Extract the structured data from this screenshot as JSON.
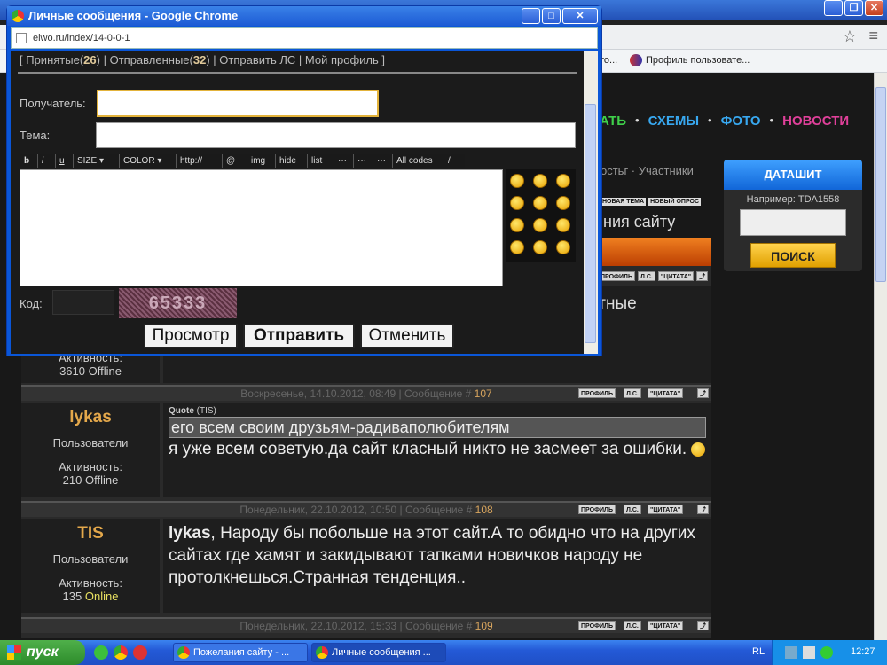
{
  "background": {
    "bookmark": "Профиль пользовате...",
    "bookmark_prefix": "то...",
    "nav": [
      {
        "label": "АТЬ",
        "color": "#3fd04a"
      },
      {
        "label": "СХЕМЫ",
        "color": "#38a8f0"
      },
      {
        "label": "ФОТО",
        "color": "#38a8f0"
      },
      {
        "label": "НОВОСТИ",
        "color": "#e0409a"
      }
    ],
    "subnav": "остьг · Участники",
    "section_title": "ния сайту",
    "tag_btns": [
      "НОВАЯ ТЕМА",
      "НОВЫЙ ОПРОС"
    ],
    "datasheet": {
      "title": "ДАТАШИТ",
      "example": "Например: TDA1558",
      "search": "ПОИСК"
    },
    "prev_text": "ятные",
    "post_buttons": [
      "ПРОФИЛЬ",
      "Л.С.",
      "\"ЦИТАТА\"",
      "⤴"
    ],
    "first_user": {
      "activity": "Активность:",
      "count": "3610 Offline"
    },
    "posts": [
      {
        "date": "Воскресенье, 14.10.2012, 08:49 | Сообщение #",
        "num": "107",
        "user": "lykas",
        "group": "Пользователи",
        "activity": "Активность:",
        "count": "210",
        "status": "Offline",
        "quote_label": "Quote",
        "quote_author": "(TIS)",
        "quote": "его всем своим друзьям-радиваполюбителям",
        "text": "я уже всем советую.да сайт класный никто не засмеет за ошибки."
      },
      {
        "date": "Понедельник, 22.10.2012, 10:50 | Сообщение #",
        "num": "108",
        "user": "TIS",
        "group": "Пользователи",
        "activity": "Активность:",
        "count": "135",
        "status": "Online",
        "mention": "lykas",
        "text": ", Народу бы побольше на этот сайт.А то обидно что на других сайтах где хамят и закидывают тапками новичков народу не протолкнешься.Странная тенденция.."
      },
      {
        "date": "Понедельник, 22.10.2012, 15:33 | Сообщение #",
        "num": "109"
      }
    ]
  },
  "popup": {
    "title": "Личные сообщения - Google Chrome",
    "url": "elwo.ru/index/14-0-0-1",
    "nav": {
      "inbox": "Принятые",
      "inbox_count": "26",
      "sent": "Отправленные",
      "sent_count": "32",
      "send": "Отправить ЛС",
      "profile": "Мой профиль"
    },
    "labels": {
      "recipient": "Получатель:",
      "subject": "Тема:",
      "code": "Код:"
    },
    "captcha": "65333",
    "bbcodes": [
      "b",
      "i",
      "u",
      "SIZE ▾",
      "COLOR ▾",
      "http://",
      "@",
      "img",
      "hide",
      "list",
      "···",
      "···",
      "···",
      "All codes",
      "/"
    ],
    "buttons": {
      "preview": "Просмотр",
      "send": "Отправить",
      "cancel": "Отменить"
    }
  },
  "taskbar": {
    "start": "пуск",
    "tasks": [
      {
        "label": "Пожелания сайту - ..."
      },
      {
        "label": "Личные сообщения ..."
      }
    ],
    "lang": "RL",
    "time": "12:27"
  }
}
